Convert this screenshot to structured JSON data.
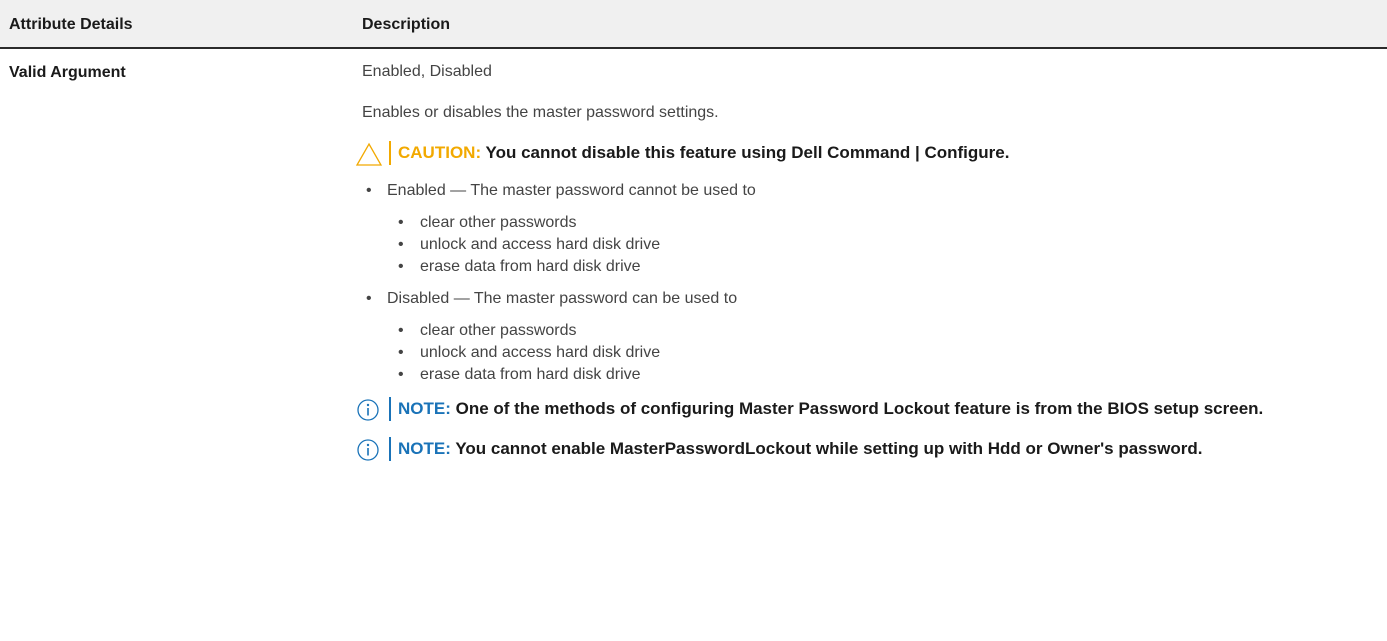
{
  "table": {
    "header": {
      "col1": "Attribute Details",
      "col2": "Description"
    },
    "row": {
      "label": "Valid Argument",
      "valid_values": "Enabled, Disabled",
      "summary": "Enables or disables the master password settings.",
      "caution": {
        "tag": "CAUTION:",
        "text": "You cannot disable this feature using Dell Command | Configure.",
        "icon": "warning-triangle-icon",
        "color": "#f2a900"
      },
      "options": [
        {
          "text": "Enabled — The master password cannot be used to",
          "items": [
            "clear other passwords",
            "unlock and access hard disk drive",
            "erase data from hard disk drive"
          ]
        },
        {
          "text": "Disabled — The master password can be used to",
          "items": [
            "clear other passwords",
            "unlock and access hard disk drive",
            "erase data from hard disk drive"
          ]
        }
      ],
      "notes": [
        {
          "tag": "NOTE:",
          "text": "One of the methods of configuring Master Password Lockout feature is from the BIOS setup screen.",
          "icon": "info-circle-icon"
        },
        {
          "tag": "NOTE:",
          "text": "You cannot enable MasterPasswordLockout while setting up with Hdd or Owner's password.",
          "icon": "info-circle-icon"
        }
      ],
      "note_color": "#1a73b8"
    }
  },
  "bullet_glyph": "•"
}
